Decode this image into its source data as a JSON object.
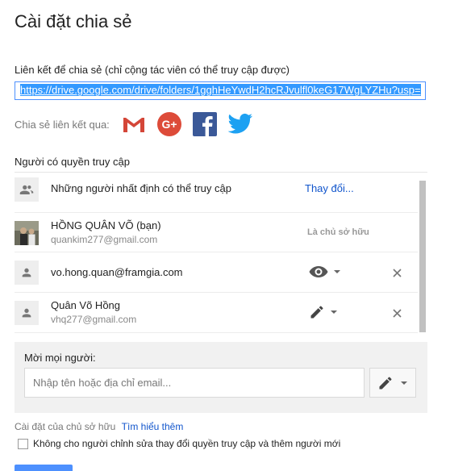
{
  "dialog": {
    "title": "Cài đặt chia sẻ",
    "link_label": "Liên kết để chia sẻ (chỉ cộng tác viên có thể truy cập được)",
    "link_value": "https://drive.google.com/drive/folders/1gghHeYwdH2hcRJvulfl0keG17WgLYZHu?usp=",
    "share_via_label": "Chia sẻ liên kết qua:",
    "share_icons": [
      "gmail-icon",
      "google-plus-icon",
      "facebook-icon",
      "twitter-icon"
    ],
    "access_label": "Người có quyền truy cập"
  },
  "access_rows": [
    {
      "name": "Những người nhất định có thể truy cập",
      "action": "Thay đổi..."
    },
    {
      "name": "HỒNG QUÂN VÕ (bạn)",
      "email": "quankim277@gmail.com",
      "role": "Là chủ sở hữu"
    },
    {
      "name": "vo.hong.quan@framgia.com",
      "permission_icon": "eye-icon"
    },
    {
      "name": "Quân Võ Hồng",
      "email": "vhq277@gmail.com",
      "permission_icon": "pencil-icon"
    }
  ],
  "invite": {
    "label": "Mời mọi người:",
    "placeholder": "Nhập tên hoặc địa chỉ email..."
  },
  "owner_settings": {
    "label": "Cài đặt của chủ sở hữu",
    "learn_more": "Tìm hiểu thêm",
    "checkbox_label": "Không cho người chỉnh sửa thay đổi quyền truy cập và thêm người mới"
  },
  "colors": {
    "accent": "#4d90fe",
    "link": "#1155cc"
  }
}
